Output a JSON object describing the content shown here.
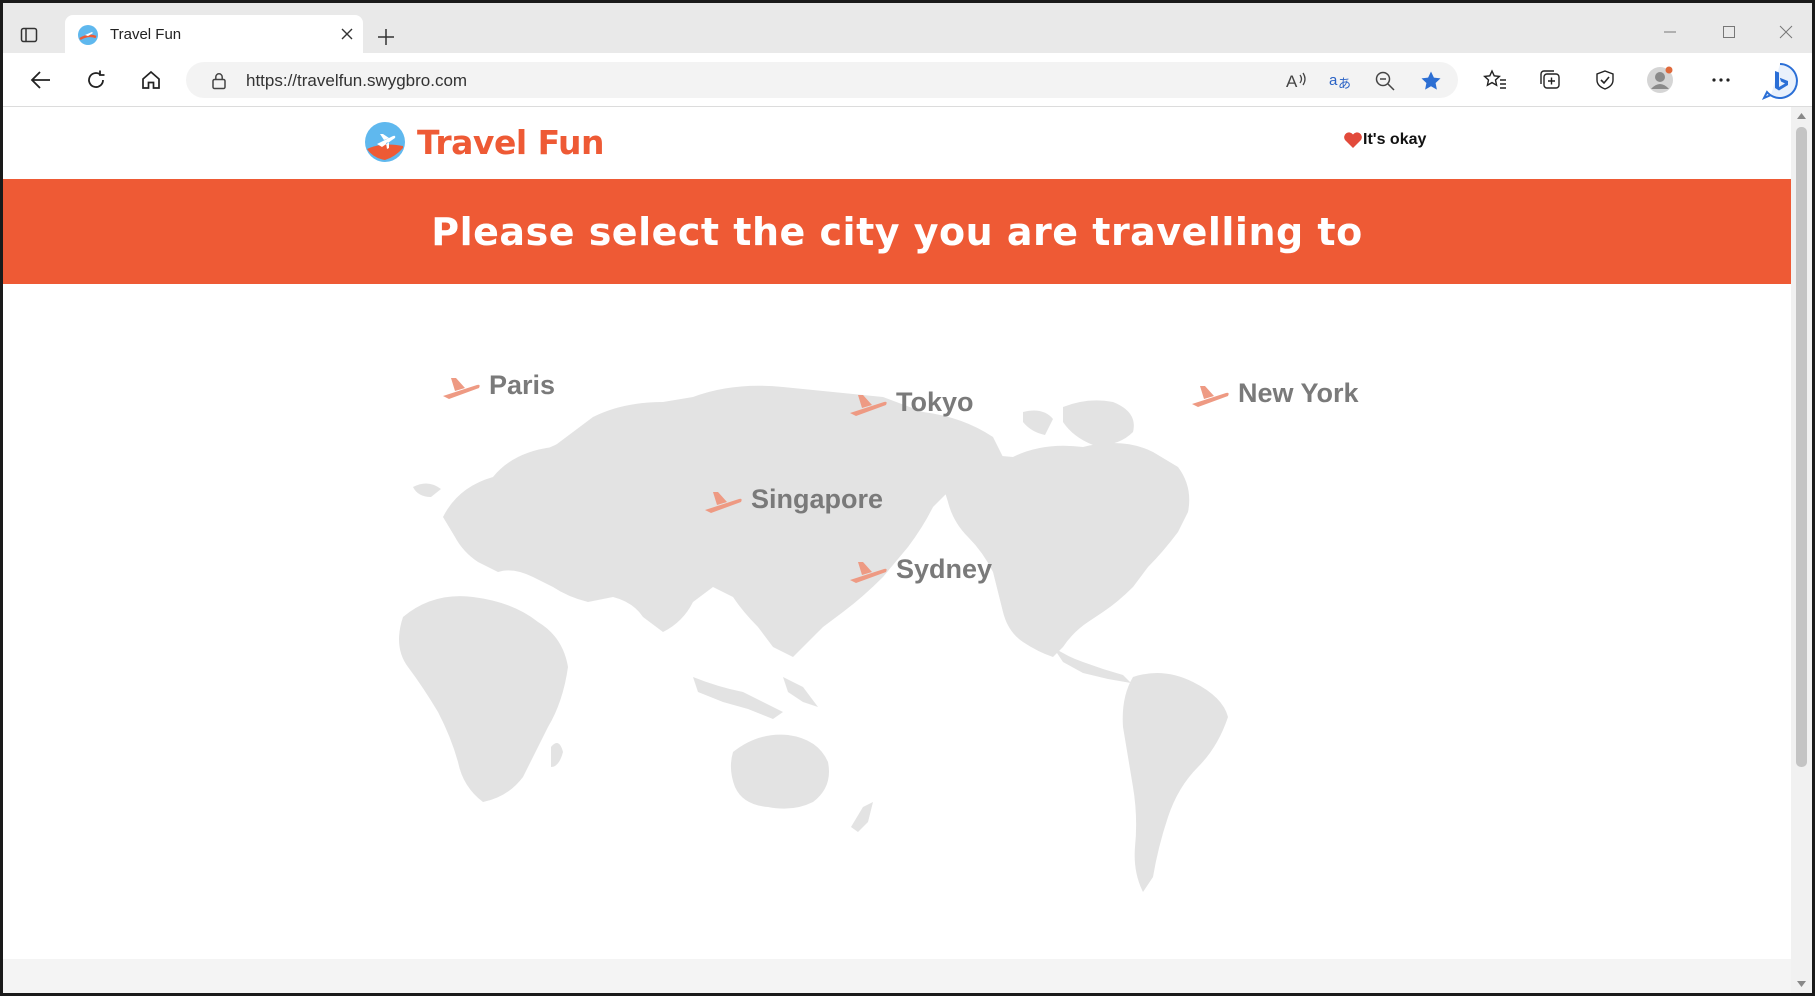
{
  "browser": {
    "tab_title": "Travel Fun",
    "url": "https://travelfun.swygbro.com",
    "icons": [
      "tab-actions-icon",
      "favicon-icon",
      "close-icon",
      "plus-icon",
      "minimize-icon",
      "maximize-icon",
      "window-close-icon",
      "back-icon",
      "refresh-icon",
      "home-icon",
      "lock-icon",
      "read-aloud-icon",
      "translate-icon",
      "zoom-out-icon",
      "favorite-star-icon",
      "favorites-icon",
      "collections-icon",
      "browser-essentials-icon",
      "profile-icon",
      "more-icon",
      "bing-icon"
    ]
  },
  "site": {
    "logo_text": "Travel Fun",
    "okay_text": "It's okay",
    "hero_title": "Please select the city you are travelling to",
    "accent_color": "#ee5a35"
  },
  "cities": [
    {
      "name": "Paris"
    },
    {
      "name": "Tokyo"
    },
    {
      "name": "New York"
    },
    {
      "name": "Singapore"
    },
    {
      "name": "Sydney"
    }
  ]
}
